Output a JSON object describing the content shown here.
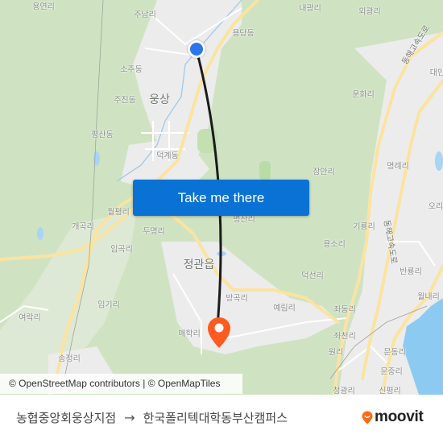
{
  "map": {
    "colors": {
      "forest": "#cfe3c2",
      "urban": "#eeeeee",
      "major_road": "#fbe6a0",
      "water": "#a8d4f5",
      "sea": "#7fc3f0",
      "route_line": "#1b1b1b",
      "origin_marker": "#2a76ec",
      "destination_marker": "#ff5a1f"
    },
    "places": [
      {
        "name": "용연리"
      },
      {
        "name": "주남리"
      },
      {
        "name": "내광리"
      },
      {
        "name": "외광리"
      },
      {
        "name": "용당동"
      },
      {
        "name": "동해고속도로"
      },
      {
        "name": "대인"
      },
      {
        "name": "소주동"
      },
      {
        "name": "주진동"
      },
      {
        "name": "웅상"
      },
      {
        "name": "운화리"
      },
      {
        "name": "평산동"
      },
      {
        "name": "덕계동"
      },
      {
        "name": "장안리"
      },
      {
        "name": "명례리"
      },
      {
        "name": "오리"
      },
      {
        "name": "월평리"
      },
      {
        "name": "개곡리"
      },
      {
        "name": "두명리"
      },
      {
        "name": "임곡리"
      },
      {
        "name": "정관읍"
      },
      {
        "name": "병산리"
      },
      {
        "name": "기룡리"
      },
      {
        "name": "용소리"
      },
      {
        "name": "동해고속도로"
      },
      {
        "name": "반룡리"
      },
      {
        "name": "덕선리"
      },
      {
        "name": "월내리"
      },
      {
        "name": "임기리"
      },
      {
        "name": "방곡리"
      },
      {
        "name": "예림리"
      },
      {
        "name": "좌동리"
      },
      {
        "name": "여락리"
      },
      {
        "name": "매학리"
      },
      {
        "name": "좌천리"
      },
      {
        "name": "원리"
      },
      {
        "name": "문동리"
      },
      {
        "name": "송정리"
      },
      {
        "name": "문중리"
      },
      {
        "name": "청광리"
      },
      {
        "name": "신평리"
      }
    ],
    "attribution": "© OpenStreetMap contributors | © OpenMapTiles",
    "cta_label": "Take me there"
  },
  "footer": {
    "origin": "농협중앙회웅상지점",
    "arrow": "→",
    "destination": "한국폴리텍대학동부산캠퍼스",
    "brand": "moovit"
  }
}
